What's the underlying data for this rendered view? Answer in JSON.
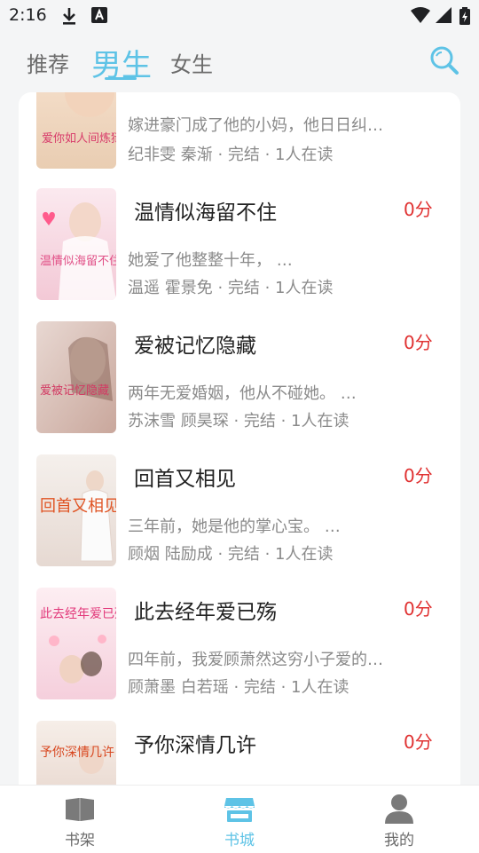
{
  "status_bar": {
    "time": "2:16"
  },
  "tabs": [
    {
      "label": "推荐"
    },
    {
      "label": "男生"
    },
    {
      "label": "女生"
    }
  ],
  "books": [
    {
      "title": "",
      "score": "",
      "desc": "嫁进豪门成了他的小妈，他日日纠…",
      "meta": "纪非雯 秦渐 · 完结 · 1人在读",
      "cover_text": "爱你如人间炼狱"
    },
    {
      "title": "温情似海留不住",
      "score": "0分",
      "desc": "她爱了他整整十年，  …",
      "meta": "温遥 霍景免 · 完结 · 1人在读",
      "cover_text": "温情似海留不住"
    },
    {
      "title": "爱被记忆隐藏",
      "score": "0分",
      "desc": "两年无爱婚姻，他从不碰她。 …",
      "meta": "苏沫雪 顾昊琛 · 完结 · 1人在读",
      "cover_text": "爱被记忆隐藏"
    },
    {
      "title": "回首又相见",
      "score": "0分",
      "desc": "三年前，她是他的掌心宝。 …",
      "meta": "顾烟 陆励成 · 完结 · 1人在读",
      "cover_text": "回首又相见"
    },
    {
      "title": "此去经年爱已殇",
      "score": "0分",
      "desc": "四年前，我爱顾萧然这穷小子爱的…",
      "meta": "顾萧墨 白若瑶 · 完结 · 1人在读",
      "cover_text": "此去经年爱已殇"
    },
    {
      "title": "予你深情几许",
      "score": "0分",
      "desc": "",
      "meta": "",
      "cover_text": "予你深情几许"
    }
  ],
  "bottom_nav": [
    {
      "label": "书架",
      "icon": "book-icon"
    },
    {
      "label": "书城",
      "icon": "store-icon"
    },
    {
      "label": "我的",
      "icon": "person-icon"
    }
  ],
  "colors": {
    "accent": "#5ec3e6",
    "score": "#e03131"
  }
}
